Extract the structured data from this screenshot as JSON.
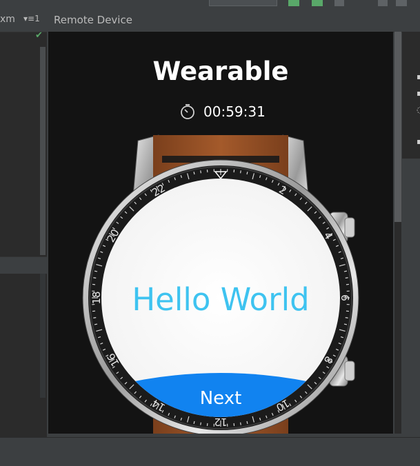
{
  "toolbar": {
    "label": ""
  },
  "editor": {
    "tab_label": "xm",
    "tab_menu": "▾≡1"
  },
  "remote_device": {
    "title": "Remote Device"
  },
  "watch": {
    "app_title": "Wearable",
    "timer_value": "00:59:31",
    "hello_text": "Hello World",
    "next_label": "Next",
    "bezel_numbers": [
      "2",
      "4",
      "6",
      "8",
      "10",
      "12",
      "14",
      "16",
      "18",
      "20",
      "22"
    ]
  },
  "colors": {
    "ide_background": "#3c3f41",
    "editor_background": "#2b2b2b",
    "screen_background": "#131313",
    "accent_blue": "#1183f0",
    "hello_color": "#3ec3f0",
    "check_green": "#59a869"
  },
  "icons": [
    "check-icon",
    "stopwatch-icon",
    "watch-crown-icon"
  ]
}
